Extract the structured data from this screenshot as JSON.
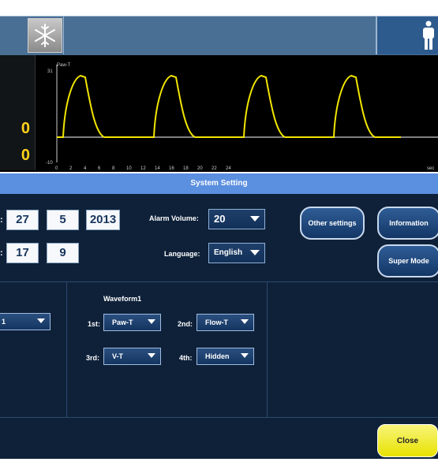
{
  "waveform": {
    "label": "Paw-T",
    "y_top": "31",
    "y_bottom": "-10",
    "x_ticks": [
      "0",
      "2",
      "4",
      "6",
      "8",
      "10",
      "12",
      "14",
      "16",
      "18",
      "20",
      "22",
      "24"
    ],
    "x_unit": "sec"
  },
  "values": {
    "top": "0",
    "bottom": "0"
  },
  "title": "System Setting",
  "date": {
    "field1": "27",
    "field2": "5",
    "field3": "2013"
  },
  "time": {
    "field1": "17",
    "field2": "9"
  },
  "alarm": {
    "label": "Alarm Volume:",
    "value": "20"
  },
  "language": {
    "label": "Language:",
    "value": "English"
  },
  "buttons": {
    "other_settings": "Other settings",
    "information": "Information",
    "super_mode": "Super Mode",
    "close": "Close"
  },
  "left_dropdown": {
    "value": "1"
  },
  "waveform_panel": {
    "title": "Waveform1",
    "slots": [
      {
        "label": "1st:",
        "value": "Paw-T"
      },
      {
        "label": "2nd:",
        "value": "Flow-T"
      },
      {
        "label": "3rd:",
        "value": "V-T"
      },
      {
        "label": "4th:",
        "value": "Hidden"
      }
    ]
  },
  "colors": {
    "wave": "#f2e600",
    "title_bar": "#5b8fe0",
    "panel": "#0e2139",
    "close": "#e8e200"
  }
}
